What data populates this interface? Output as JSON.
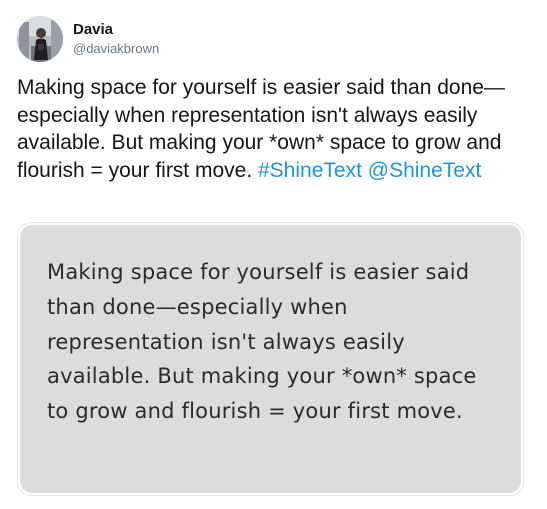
{
  "author": {
    "display_name": "Davia",
    "handle": "@daviakbrown"
  },
  "tweet": {
    "text_main": "Making space for yourself is easier said than done—especially when representation isn't always easily available. But making your *own* space to grow and flourish = your first move. ",
    "hashtag": "#ShineText",
    "separator": " ",
    "mention": "@ShineText"
  },
  "media": {
    "quote_text": "Making space for yourself is easier said than done—especially when representation isn't always easily available. But making your *own* space to grow and flourish = your first move.",
    "background_color": "#dcdcdc"
  },
  "colors": {
    "link": "#1b95e0",
    "handle": "#657786",
    "text": "#14171a"
  }
}
